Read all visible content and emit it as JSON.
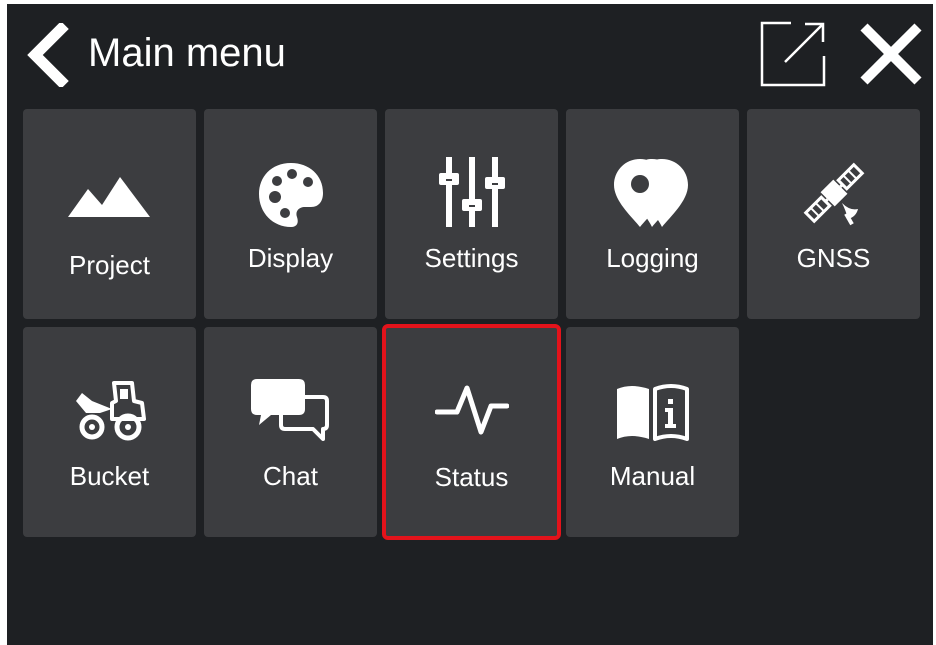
{
  "header": {
    "title": "Main menu",
    "back_icon": "chevron-left-icon",
    "popout_icon": "external-window-icon",
    "close_icon": "close-icon"
  },
  "tiles": [
    {
      "label": "Project",
      "icon": "mountains-icon"
    },
    {
      "label": "Display",
      "icon": "palette-icon"
    },
    {
      "label": "Settings",
      "icon": "sliders-icon"
    },
    {
      "label": "Logging",
      "icon": "map-pins-icon"
    },
    {
      "label": "GNSS",
      "icon": "satellite-icon"
    },
    {
      "label": "Bucket",
      "icon": "wheel-loader-icon"
    },
    {
      "label": "Chat",
      "icon": "chat-bubbles-icon"
    },
    {
      "label": "Status",
      "icon": "pulse-icon",
      "selected": true
    },
    {
      "label": "Manual",
      "icon": "manual-book-icon"
    }
  ],
  "colors": {
    "background": "#1e2023",
    "tile": "#3c3d40",
    "selection": "#e3131b",
    "text": "#ffffff"
  }
}
